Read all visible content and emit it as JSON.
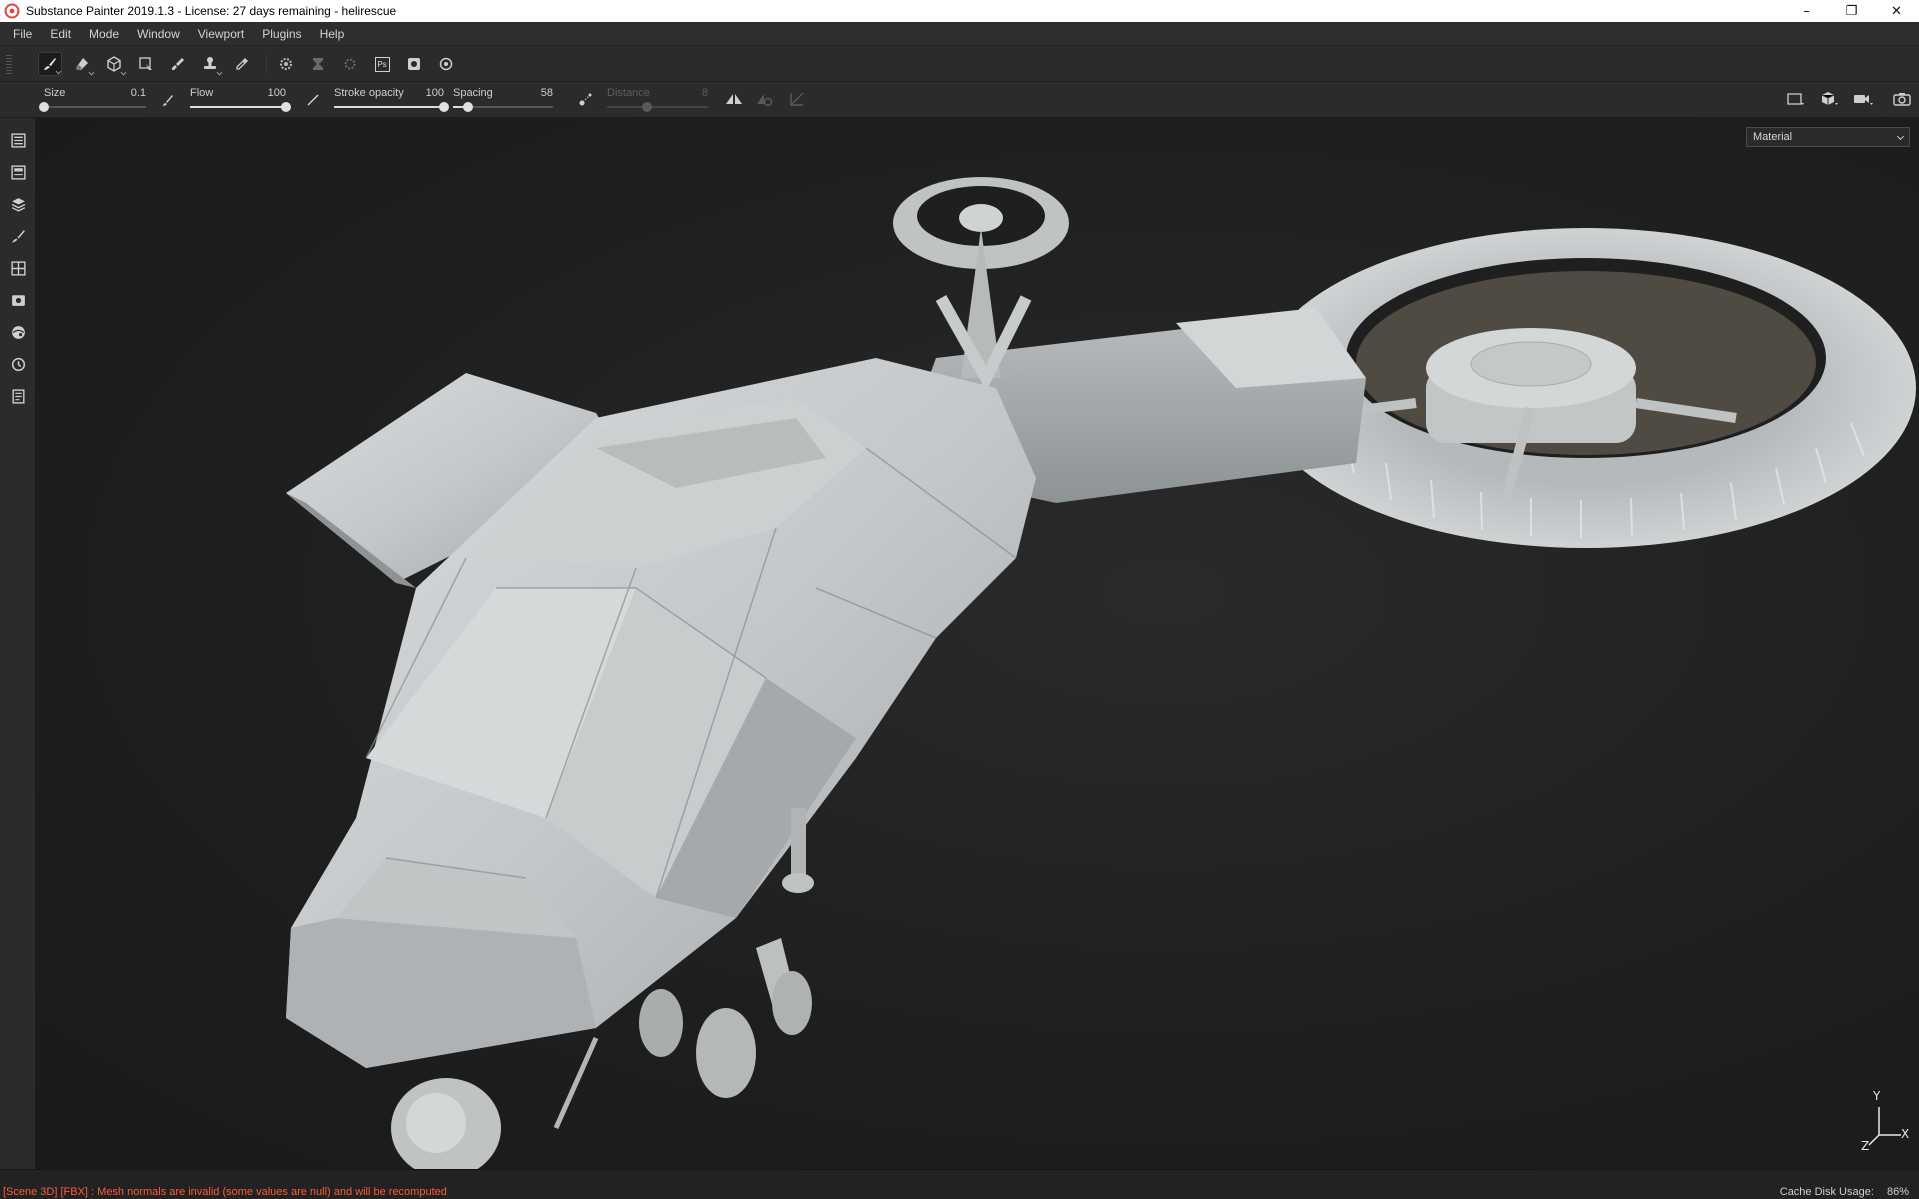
{
  "window": {
    "title": "Substance Painter 2019.1.3 - License: 27 days remaining - helirescue",
    "controls": {
      "minimize": "–",
      "restore": "❐",
      "close": "✕"
    }
  },
  "menu": [
    "File",
    "Edit",
    "Mode",
    "Window",
    "Viewport",
    "Plugins",
    "Help"
  ],
  "toolbar": {
    "tools": [
      "paint-brush",
      "eraser",
      "projection",
      "polygon-fill",
      "smudge",
      "clone-stamp",
      "color-picker"
    ],
    "active_tool": "paint-brush",
    "export_icons": [
      "bake-icon",
      "texture-set-icon",
      "iray-icon"
    ],
    "photoshop_label": "Ps"
  },
  "properties": {
    "size": {
      "label": "Size",
      "value": "0.1",
      "level": 0.0
    },
    "flow": {
      "label": "Flow",
      "value": "100",
      "level": 1.0
    },
    "stroke_opacity": {
      "label": "Stroke opacity",
      "value": "100",
      "level": 1.0
    },
    "spacing": {
      "label": "Spacing",
      "value": "58",
      "level": 0.15
    },
    "distance": {
      "label": "Distance",
      "value": "8",
      "level": 0.4,
      "enabled": false
    }
  },
  "sidebar": [
    "layers-stack-icon",
    "texture-set-list-icon",
    "layers-icon",
    "brush-settings-icon",
    "uv-tiles-icon",
    "display-settings-icon",
    "shelf-icon",
    "history-icon",
    "log-icon"
  ],
  "viewport": {
    "channel": "Material",
    "axes": {
      "y": "Y",
      "x": "X",
      "z": "Z"
    }
  },
  "status": {
    "message": "[Scene 3D] [FBX] : Mesh normals are invalid (some values are null) and will be recomputed",
    "cache_label": "Cache Disk Usage:",
    "cache_value": "86%"
  },
  "colors": {
    "accent_error": "#ff5a3c",
    "panel": "#2b2b2b",
    "viewport_bg": "#1e1e1e",
    "model": "#c9cdcf"
  }
}
